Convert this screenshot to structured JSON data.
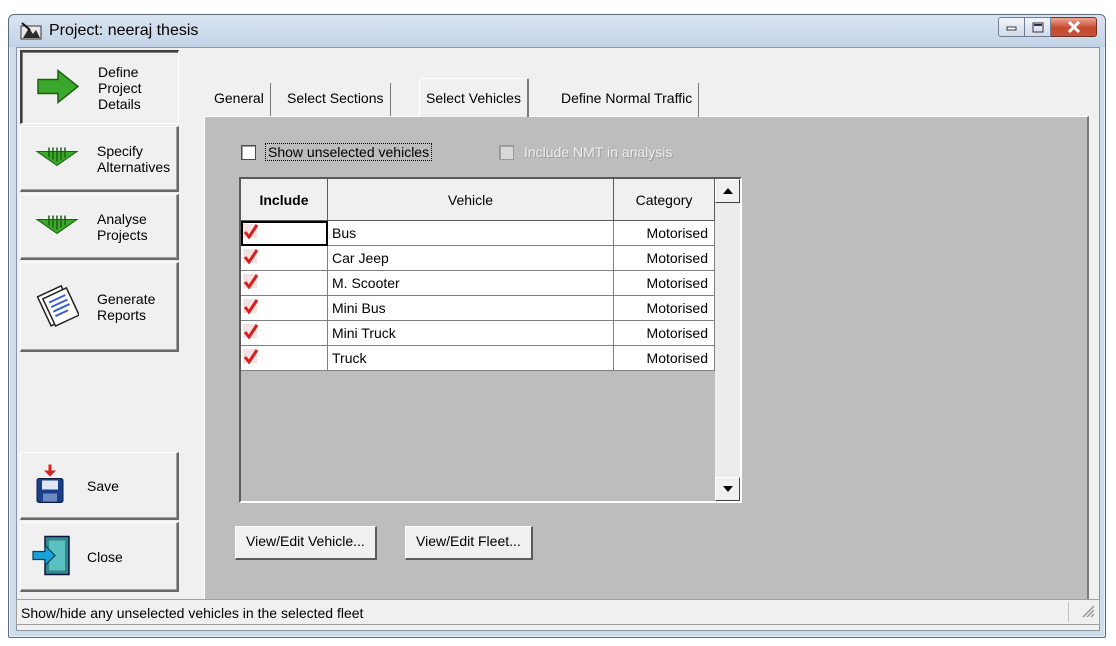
{
  "window": {
    "title": "Project: neeraj thesis",
    "controls": [
      "minimize-icon",
      "maximize-icon",
      "close-icon"
    ]
  },
  "nav": [
    {
      "label": "Define\nProject\nDetails",
      "icon": "green-arrow-right-icon",
      "active": true
    },
    {
      "label": "Specify\nAlternatives",
      "icon": "green-arrow-down-icon",
      "active": false
    },
    {
      "label": "Analyse\nProjects",
      "icon": "green-arrow-down-icon",
      "active": false
    },
    {
      "label": "Generate\nReports",
      "icon": "reports-icon",
      "active": false
    }
  ],
  "actions": {
    "save_label": "Save",
    "close_label": "Close"
  },
  "tabs": [
    {
      "label": "General",
      "selected": false
    },
    {
      "label": "Select Sections",
      "selected": false
    },
    {
      "label": "Select Vehicles",
      "selected": true
    },
    {
      "label": "Define Normal Traffic",
      "selected": false
    }
  ],
  "options": {
    "show_unselected": {
      "label": "Show unselected vehicles",
      "checked": false
    },
    "include_nmt": {
      "label": "Include NMT in analysis",
      "checked": false,
      "enabled": false
    }
  },
  "grid": {
    "columns": [
      "Include",
      "Vehicle",
      "Category"
    ],
    "rows": [
      {
        "include": true,
        "vehicle": "Bus",
        "category": "Motorised"
      },
      {
        "include": true,
        "vehicle": "Car Jeep",
        "category": "Motorised"
      },
      {
        "include": true,
        "vehicle": "M. Scooter",
        "category": "Motorised"
      },
      {
        "include": true,
        "vehicle": "Mini Bus",
        "category": "Motorised"
      },
      {
        "include": true,
        "vehicle": "Mini Truck",
        "category": "Motorised"
      },
      {
        "include": true,
        "vehicle": "Truck",
        "category": "Motorised"
      }
    ]
  },
  "buttons": {
    "view_edit_vehicle": "View/Edit Vehicle...",
    "view_edit_fleet": "View/Edit Fleet..."
  },
  "status": {
    "text": "Show/hide any unselected vehicles in the selected fleet"
  },
  "colors": {
    "panel_bg": "#bdbdbd",
    "button_face": "#f0f0f0",
    "nav_arrow": "#2e9a1e",
    "check_red": "#d81e1e",
    "close_red": "#c6492d"
  }
}
